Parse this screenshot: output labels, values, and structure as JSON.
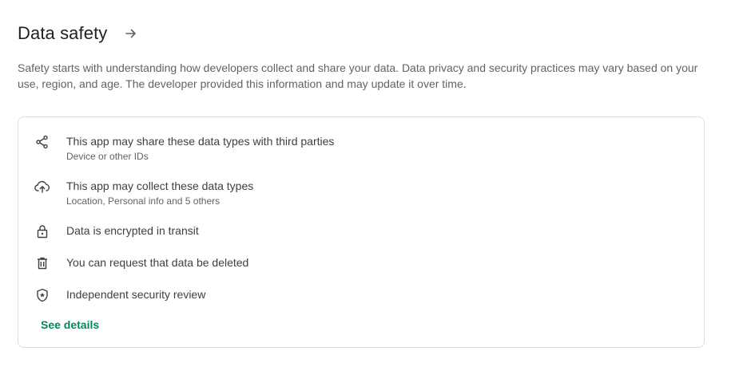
{
  "section": {
    "title": "Data safety",
    "arrow_icon": "arrow-right-icon",
    "intro": "Safety starts with understanding how developers collect and share your data. Data privacy and security practices may vary based on your use, region, and age. The developer provided this information and may update it over time."
  },
  "card": {
    "items": [
      {
        "icon": "share-icon",
        "label": "This app may share these data types with third parties",
        "sublabel": "Device or other IDs"
      },
      {
        "icon": "cloud-upload-icon",
        "label": "This app may collect these data types",
        "sublabel": "Location, Personal info and 5 others"
      },
      {
        "icon": "lock-icon",
        "label": "Data is encrypted in transit"
      },
      {
        "icon": "trash-icon",
        "label": "You can request that data be deleted"
      },
      {
        "icon": "shield-star-icon",
        "label": "Independent security review"
      }
    ],
    "see_details": "See details"
  },
  "colors": {
    "link_green": "#01875f",
    "text_primary": "#3c4043",
    "text_secondary": "#5f6368",
    "border": "#dadce0"
  }
}
